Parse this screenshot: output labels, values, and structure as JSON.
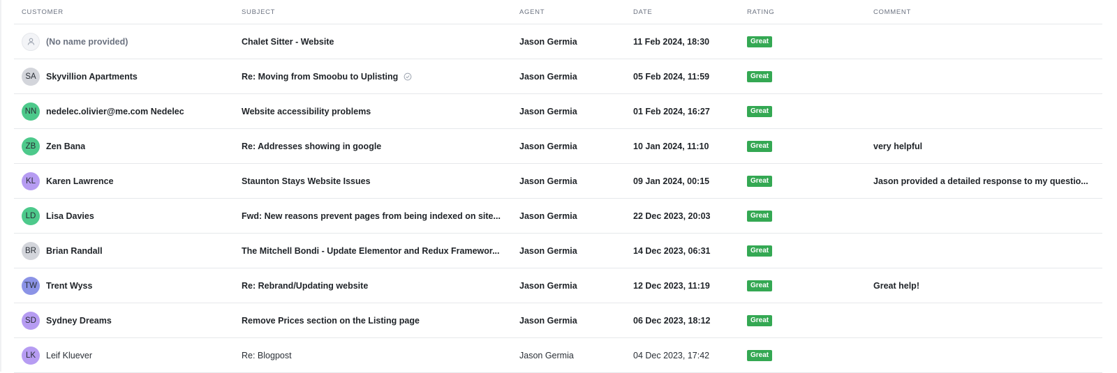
{
  "columns": {
    "customer": "CUSTOMER",
    "subject": "SUBJECT",
    "agent": "AGENT",
    "date": "DATE",
    "rating": "RATING",
    "comment": "COMMENT"
  },
  "colors": {
    "badge_green": "#34a853",
    "avatar_gray": "#d3d5db",
    "avatar_green": "#4dc98b",
    "avatar_purple": "#b69cf2",
    "avatar_blue": "#8b93e6"
  },
  "rows": [
    {
      "initials": "",
      "avatar_icon": "user-icon",
      "customer": "(No name provided)",
      "subject": "Chalet Sitter - Website",
      "agent": "Jason Germia",
      "date": "11 Feb 2024, 18:30",
      "rating": "Great",
      "comment": ""
    },
    {
      "initials": "SA",
      "customer": "Skyvillion Apartments",
      "subject": "Re: Moving from Smoobu to Uplisting",
      "subject_icon": "check-circle-icon",
      "agent": "Jason Germia",
      "date": "05 Feb 2024, 11:59",
      "rating": "Great",
      "comment": ""
    },
    {
      "initials": "NN",
      "customer": "nedelec.olivier@me.com Nedelec",
      "subject": "Website accessibility problems",
      "agent": "Jason Germia",
      "date": "01 Feb 2024, 16:27",
      "rating": "Great",
      "comment": ""
    },
    {
      "initials": "ZB",
      "customer": "Zen Bana",
      "subject": "Re: Addresses showing in google",
      "agent": "Jason Germia",
      "date": "10 Jan 2024, 11:10",
      "rating": "Great",
      "comment": "very helpful"
    },
    {
      "initials": "KL",
      "customer": "Karen Lawrence",
      "subject": "Staunton Stays Website Issues",
      "agent": "Jason Germia",
      "date": "09 Jan 2024, 00:15",
      "rating": "Great",
      "comment": "Jason provided a detailed response to my questio..."
    },
    {
      "initials": "LD",
      "customer": "Lisa Davies",
      "subject": "Fwd: New reasons prevent pages from being indexed on site...",
      "agent": "Jason Germia",
      "date": "22 Dec 2023, 20:03",
      "rating": "Great",
      "comment": ""
    },
    {
      "initials": "BR",
      "customer": "Brian Randall",
      "subject": "The Mitchell Bondi - Update Elementor and Redux Framewor...",
      "agent": "Jason Germia",
      "date": "14 Dec 2023, 06:31",
      "rating": "Great",
      "comment": ""
    },
    {
      "initials": "TW",
      "customer": "Trent Wyss",
      "subject": "Re: Rebrand/Updating website",
      "agent": "Jason Germia",
      "date": "12 Dec 2023, 11:19",
      "rating": "Great",
      "comment": "Great help!"
    },
    {
      "initials": "SD",
      "customer": "Sydney Dreams",
      "subject": "Remove Prices section on the Listing page",
      "agent": "Jason Germia",
      "date": "06 Dec 2023, 18:12",
      "rating": "Great",
      "comment": ""
    },
    {
      "initials": "LK",
      "customer": "Leif Kluever",
      "subject": "Re: Blogpost",
      "agent": "Jason Germia",
      "date": "04 Dec 2023, 17:42",
      "rating": "Great",
      "comment": ""
    }
  ]
}
